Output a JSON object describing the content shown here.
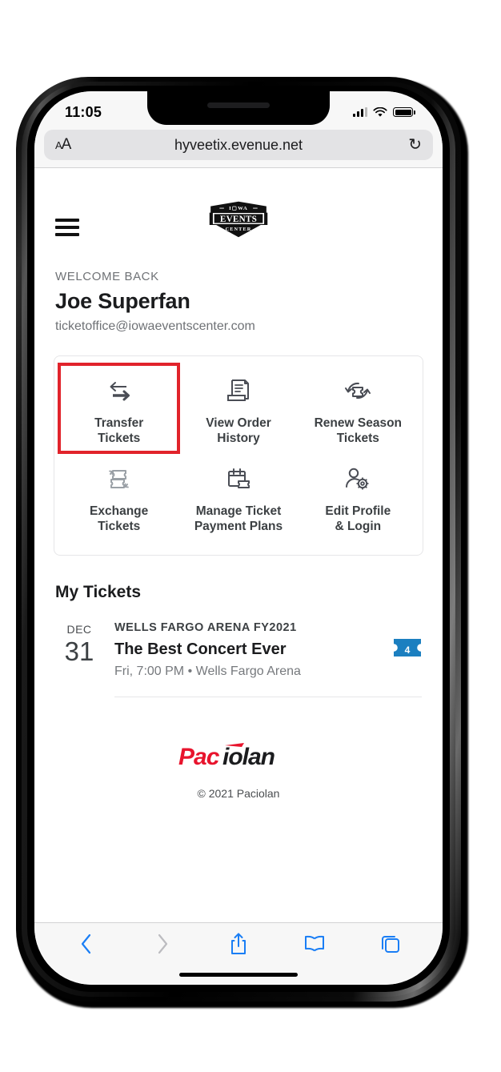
{
  "device": {
    "statusbar": {
      "clock": "11:05",
      "signal_icon": "cellular-signal-icon",
      "wifi_icon": "wifi-icon",
      "battery_icon": "battery-full-icon"
    },
    "browser": {
      "page_settings_label": "AA",
      "url": "hyveetix.evenue.net",
      "reload_icon": "reload-icon",
      "toolbar": [
        {
          "name": "back-button",
          "icon": "chevron-left-icon",
          "enabled": true
        },
        {
          "name": "forward-button",
          "icon": "chevron-right-icon",
          "enabled": false
        },
        {
          "name": "share-button",
          "icon": "share-icon",
          "enabled": true
        },
        {
          "name": "bookmarks-button",
          "icon": "book-icon",
          "enabled": true
        },
        {
          "name": "tabs-button",
          "icon": "tabs-icon",
          "enabled": true
        }
      ]
    }
  },
  "site": {
    "menu_icon": "hamburger-menu-icon",
    "logo": {
      "name": "iowa-events-center-logo",
      "top_text": "IOWA",
      "mid_text": "EVENTS",
      "bottom_text": "CENTER"
    }
  },
  "account": {
    "welcome_label": "WELCOME BACK",
    "name": "Joe Superfan",
    "email": "ticketoffice@iowaeventscenter.com"
  },
  "actions": {
    "highlight_color": "#e1232b",
    "tiles": [
      {
        "id": "transfer-tickets",
        "label": "Transfer\nTickets",
        "icon": "transfer-arrows-icon",
        "highlighted": true
      },
      {
        "id": "view-order-history",
        "label": "View Order\nHistory",
        "icon": "receipt-scroll-icon",
        "highlighted": false
      },
      {
        "id": "renew-season-tickets",
        "label": "Renew Season\nTickets",
        "icon": "ticket-refresh-icon",
        "highlighted": false
      },
      {
        "id": "exchange-tickets",
        "label": "Exchange\nTickets",
        "icon": "ticket-exchange-icon",
        "highlighted": false
      },
      {
        "id": "manage-ticket-payment-plans",
        "label": "Manage Ticket\nPayment Plans",
        "icon": "calendar-ticket-icon",
        "highlighted": false
      },
      {
        "id": "edit-profile-login",
        "label": "Edit Profile\n& Login",
        "icon": "person-gear-icon",
        "highlighted": false
      }
    ]
  },
  "my_tickets": {
    "heading": "My Tickets",
    "events": [
      {
        "month": "DEC",
        "day": "31",
        "category": "WELLS FARGO ARENA FY2021",
        "title": "The Best Concert Ever",
        "meta": "Fri, 7:00 PM • Wells Fargo Arena",
        "quantity": "4",
        "quantity_badge_color": "#1b7fc0"
      }
    ]
  },
  "footer": {
    "logo_name": "paciolan-logo",
    "logo_text_red": "Pac",
    "logo_text_dark": "iolan",
    "logo_red": "#e8142d",
    "logo_dark": "#1b1c1e",
    "copyright": "© 2021 Paciolan"
  }
}
